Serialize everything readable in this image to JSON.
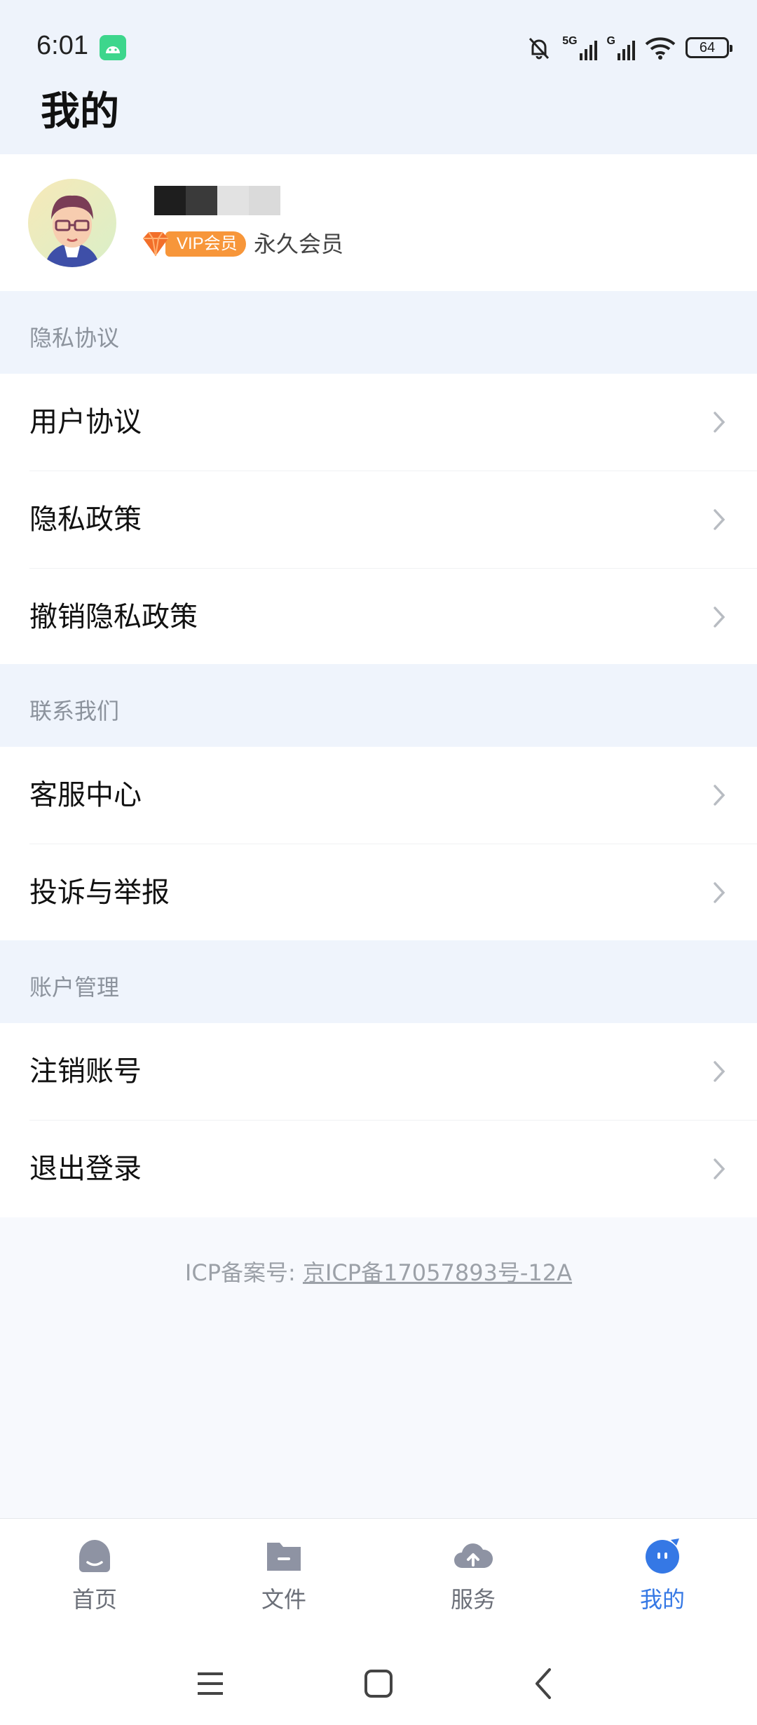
{
  "status_bar": {
    "time": "6:01",
    "signal_1": "5G",
    "signal_2": "G",
    "battery": "64"
  },
  "header": {
    "title": "我的"
  },
  "profile": {
    "vip_label": "VIP会员",
    "member_type": "永久会员"
  },
  "sections": [
    {
      "title": "隐私协议",
      "items": [
        {
          "label": "用户协议"
        },
        {
          "label": "隐私政策"
        },
        {
          "label": "撤销隐私政策"
        }
      ]
    },
    {
      "title": "联系我们",
      "items": [
        {
          "label": "客服中心"
        },
        {
          "label": "投诉与举报"
        }
      ]
    },
    {
      "title": "账户管理",
      "items": [
        {
          "label": "注销账号"
        },
        {
          "label": "退出登录"
        }
      ]
    }
  ],
  "footer": {
    "icp_prefix": "ICP备案号: ",
    "icp_number": "京ICP备17057893号-12A"
  },
  "bottom_nav": {
    "items": [
      {
        "label": "首页",
        "icon": "home-icon"
      },
      {
        "label": "文件",
        "icon": "folder-icon"
      },
      {
        "label": "服务",
        "icon": "cloud-upload-icon"
      },
      {
        "label": "我的",
        "icon": "profile-icon"
      }
    ],
    "active_index": 3
  },
  "colors": {
    "accent": "#3578e5",
    "vip": "#f7963a",
    "section_bg": "#eff4fc"
  }
}
